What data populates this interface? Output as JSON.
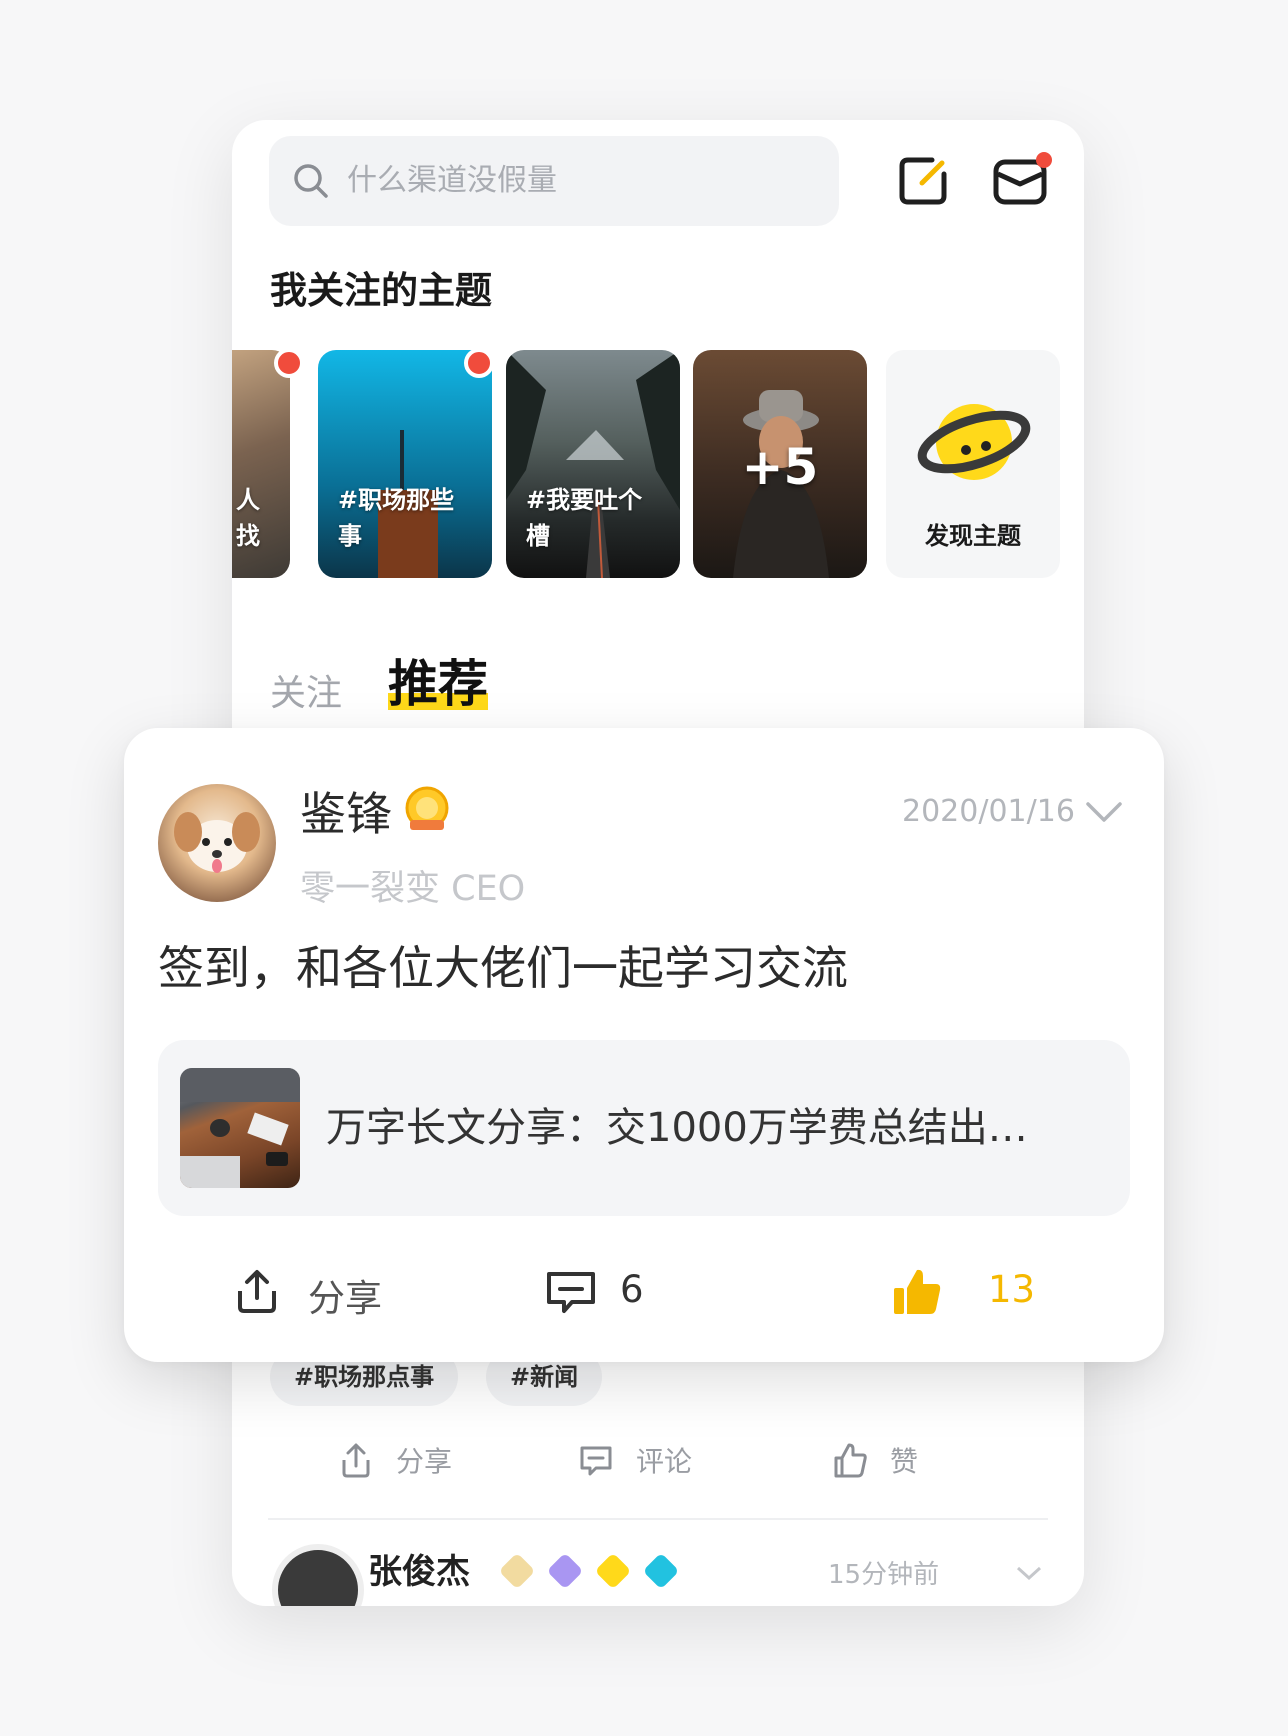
{
  "search": {
    "placeholder": "什么渠道没假量"
  },
  "section_title": "我关注的主题",
  "topics": [
    {
      "label": "人找",
      "has_dot": true
    },
    {
      "label": "#职场那些事",
      "has_dot": true
    },
    {
      "label": "#我要吐个槽",
      "has_dot": false
    },
    {
      "label": "+5",
      "has_dot": false
    },
    {
      "label": "发现主题",
      "has_dot": false
    }
  ],
  "tabs": {
    "follow": "关注",
    "recommend": "推荐"
  },
  "post": {
    "author": "鉴锋",
    "role": "零一裂变 CEO",
    "date": "2020/01/16",
    "content": "签到，和各位大佬们一起学习交流",
    "link_title": "万字长文分享：交1000万学费总结出…",
    "share_label": "分享",
    "comment_count": "6",
    "like_count": "13"
  },
  "back_post": {
    "tags": [
      "#职场那点事",
      "#新闻"
    ],
    "share_label": "分享",
    "comment_label": "评论",
    "like_label": "赞"
  },
  "peek": {
    "author": "张俊杰",
    "time": "15分钟前"
  },
  "colors": {
    "accent": "#ffd91a",
    "like": "#f5b800",
    "badge_red": "#f04c3c"
  }
}
